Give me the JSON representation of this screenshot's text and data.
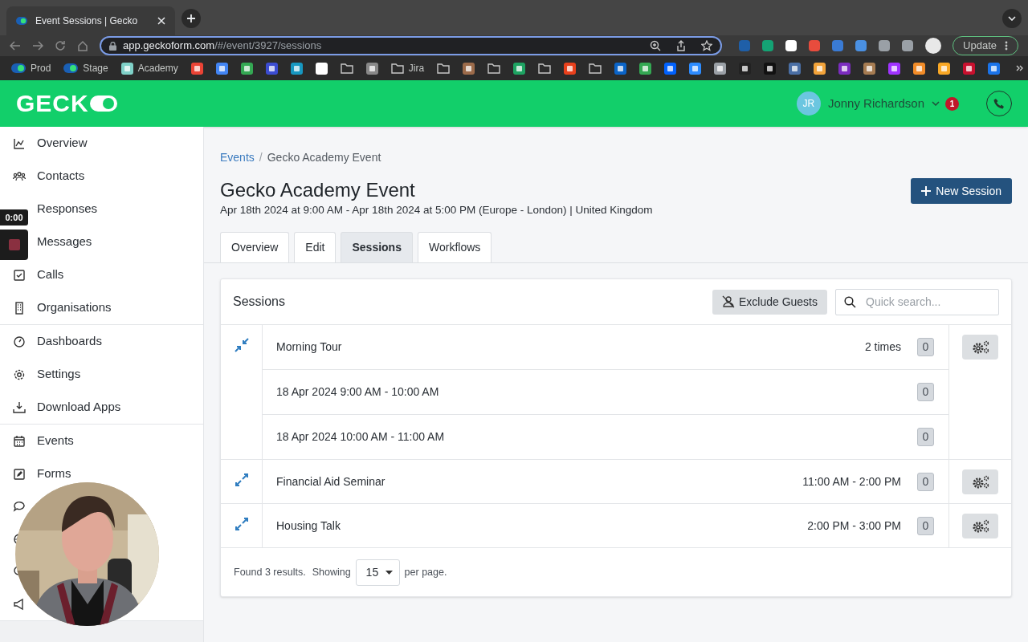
{
  "browser": {
    "tab": {
      "title": "Event Sessions | Gecko"
    },
    "url": {
      "host": "app.geckoform.com",
      "path": "/#/event/3927/sessions"
    },
    "update_button": "Update",
    "bookmarks": [
      {
        "kind": "site",
        "label": "Prod"
      },
      {
        "kind": "site",
        "label": "Stage"
      },
      {
        "kind": "site",
        "label": "Academy"
      },
      {
        "kind": "site"
      },
      {
        "kind": "site"
      },
      {
        "kind": "site"
      },
      {
        "kind": "site"
      },
      {
        "kind": "site"
      },
      {
        "kind": "site"
      },
      {
        "kind": "folder"
      },
      {
        "kind": "site"
      },
      {
        "kind": "folder",
        "label": "Jira"
      },
      {
        "kind": "folder"
      },
      {
        "kind": "site"
      },
      {
        "kind": "folder"
      },
      {
        "kind": "site"
      },
      {
        "kind": "folder"
      },
      {
        "kind": "site"
      },
      {
        "kind": "folder"
      },
      {
        "kind": "site"
      },
      {
        "kind": "site"
      },
      {
        "kind": "site"
      },
      {
        "kind": "site"
      },
      {
        "kind": "site"
      },
      {
        "kind": "site"
      },
      {
        "kind": "site"
      },
      {
        "kind": "site"
      },
      {
        "kind": "site"
      },
      {
        "kind": "site"
      },
      {
        "kind": "site"
      },
      {
        "kind": "site"
      },
      {
        "kind": "site"
      },
      {
        "kind": "site"
      },
      {
        "kind": "site"
      },
      {
        "kind": "site"
      }
    ]
  },
  "header": {
    "logo": "GECK",
    "user": {
      "initials": "JR",
      "name": "Jonny Richardson",
      "notifications": "1"
    }
  },
  "sidebar": {
    "groups": [
      {
        "items": [
          {
            "kind": "link",
            "label": "Overview"
          },
          {
            "kind": "link",
            "label": "Contacts"
          },
          {
            "kind": "label_only",
            "label": "Responses"
          },
          {
            "kind": "label_only",
            "label": "Messages"
          },
          {
            "kind": "link",
            "label": "Calls"
          },
          {
            "kind": "link",
            "label": "Organisations"
          }
        ]
      },
      {
        "items": [
          {
            "kind": "link",
            "label": "Dashboards"
          },
          {
            "kind": "link",
            "label": "Settings"
          },
          {
            "kind": "link",
            "label": "Download Apps"
          }
        ]
      },
      {
        "items": [
          {
            "kind": "link",
            "label": "Events"
          },
          {
            "kind": "link",
            "label": "Forms"
          },
          {
            "kind": "covered"
          },
          {
            "kind": "covered"
          },
          {
            "kind": "covered"
          },
          {
            "kind": "covered"
          }
        ]
      }
    ]
  },
  "recorder": {
    "time": "0:00"
  },
  "breadcrumb_separator": "/",
  "breadcrumb": [
    {
      "label": "Events",
      "link": true
    },
    {
      "label": "Gecko Academy Event",
      "link": false
    }
  ],
  "event": {
    "title": "Gecko Academy Event",
    "subtitle": "Apr 18th 2024 at 9:00 AM - Apr 18th 2024 at 5:00 PM (Europe - London) | United Kingdom"
  },
  "new_session_button": "New Session",
  "tabs": [
    {
      "label": "Overview",
      "selected": false
    },
    {
      "label": "Edit",
      "selected": false
    },
    {
      "label": "Sessions",
      "selected": true
    },
    {
      "label": "Workflows",
      "selected": false
    }
  ],
  "sessions_card": {
    "title": "Sessions",
    "exclude_button": "Exclude Guests",
    "search": {
      "placeholder": "Quick search..."
    },
    "rows": [
      {
        "name": "Morning Tour",
        "when": "2 times",
        "count": "0",
        "expanded": true,
        "children": [
          {
            "name": "18 Apr 2024 9:00 AM - 10:00 AM",
            "count": "0"
          },
          {
            "name": "18 Apr 2024 10:00 AM - 11:00 AM",
            "count": "0"
          }
        ]
      },
      {
        "name": "Financial Aid Seminar",
        "when": "11:00 AM - 2:00 PM",
        "count": "0",
        "expanded": false
      },
      {
        "name": "Housing Talk",
        "when": "2:00 PM - 3:00 PM",
        "count": "0",
        "expanded": false
      }
    ],
    "footer": {
      "found": "Found 3 results.",
      "showing": "Showing",
      "per_page_value": "15",
      "per_page": "per page."
    }
  }
}
